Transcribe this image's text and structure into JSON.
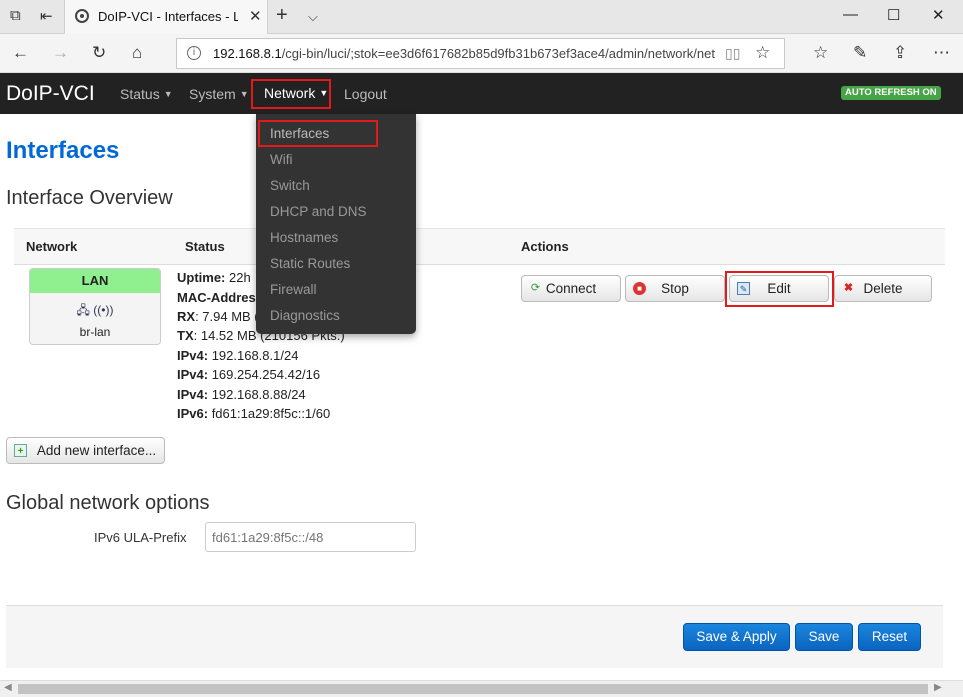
{
  "browser": {
    "tab_title": "DoIP-VCI - Interfaces - L",
    "url_host": "192.168.8.1",
    "url_rest": "/cgi-bin/luci/;stok=ee3d6f617682b85d9fb31b673ef3ace4/admin/network/netw"
  },
  "header": {
    "brand": "DoIP-VCI",
    "menu": [
      "Status",
      "System",
      "Network",
      "Logout"
    ],
    "auto_refresh": "AUTO REFRESH ON"
  },
  "dropdown": [
    "Interfaces",
    "Wifi",
    "Switch",
    "DHCP and DNS",
    "Hostnames",
    "Static Routes",
    "Firewall",
    "Diagnostics"
  ],
  "page": {
    "title": "Interfaces",
    "overview_title": "Interface Overview",
    "global_title": "Global network options"
  },
  "table": {
    "headers": {
      "network": "Network",
      "status": "Status",
      "actions": "Actions"
    }
  },
  "interface": {
    "name": "LAN",
    "device": "br-lan",
    "status_lines": [
      {
        "label": "Uptime:",
        "value": " 22h"
      },
      {
        "label": "MAC-Addres",
        "value": ""
      },
      {
        "label": "RX",
        "value": ": 7.94 MB ("
      },
      {
        "label": "TX",
        "value": ": 14.52 MB (210156 Pkts.)"
      },
      {
        "label": "IPv4:",
        "value": " 192.168.8.1/24"
      },
      {
        "label": "IPv4:",
        "value": " 169.254.254.42/16"
      },
      {
        "label": "IPv4:",
        "value": " 192.168.8.88/24"
      },
      {
        "label": "IPv6:",
        "value": " fd61:1a29:8f5c::1/60"
      }
    ],
    "actions": [
      "Connect",
      "Stop",
      "Edit",
      "Delete"
    ]
  },
  "add_interface": "Add new interface...",
  "global": {
    "ula_label": "IPv6 ULA-Prefix",
    "ula_placeholder": "fd61:1a29:8f5c::/48"
  },
  "footer_buttons": [
    "Save & Apply",
    "Save",
    "Reset"
  ],
  "colors": {
    "accent": "#0069d6",
    "highlight": "#e21a1a",
    "status_green": "#46a546"
  }
}
